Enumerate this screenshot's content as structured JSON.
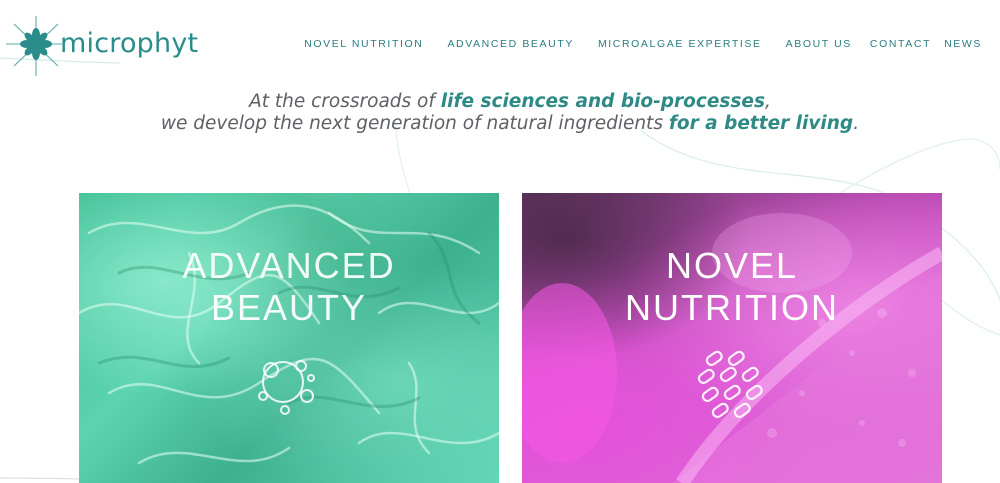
{
  "header": {
    "logo_text": "microphyt",
    "logo_icon": "star-burst-logo-icon",
    "brand_color": "#2a8c8b"
  },
  "nav": {
    "items": [
      {
        "label": "NOVEL NUTRITION"
      },
      {
        "label": "ADVANCED BEAUTY"
      },
      {
        "label": "MICROALGAE EXPERTISE"
      },
      {
        "label": "ABOUT US"
      },
      {
        "label": "CONTACT"
      },
      {
        "label": "NEWS"
      }
    ]
  },
  "tagline": {
    "line1_prefix": "At the crossroads of ",
    "line1_highlight": "life sciences and bio-processes",
    "line1_suffix": ",",
    "line2_prefix": "we develop the next generation of natural ingredients ",
    "line2_highlight": "for a better living",
    "line2_suffix": ".",
    "text_color": "#5e6066",
    "highlight_color": "#2f8a86"
  },
  "cards": [
    {
      "title": "ADVANCED\nBEAUTY",
      "icon": "bubbles-icon",
      "background": "#4fc9a3"
    },
    {
      "title": "NOVEL\nNUTRITION",
      "icon": "cells-icon",
      "background": "#d55ccf"
    }
  ]
}
